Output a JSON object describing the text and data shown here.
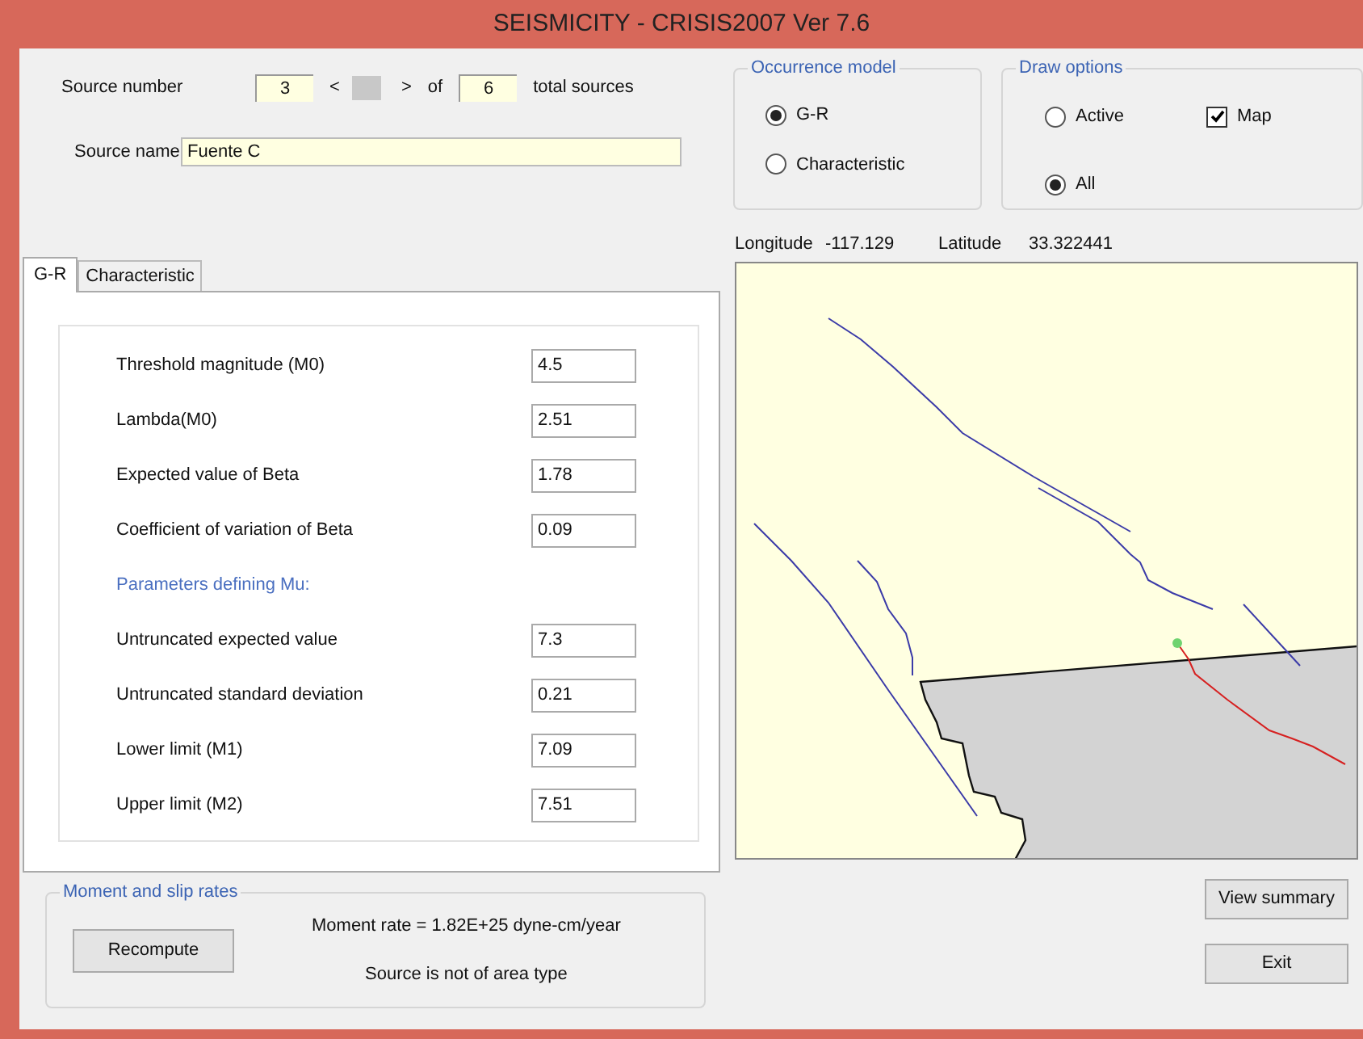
{
  "window": {
    "title": "SEISMICITY - CRISIS2007 Ver 7.6"
  },
  "source_number": {
    "label": "Source number",
    "value": "3",
    "prev": "<",
    "next": ">",
    "of": "of",
    "total": "6",
    "total_label": "total sources"
  },
  "source_name": {
    "label": "Source name",
    "value": "Fuente C"
  },
  "occurrence_model": {
    "title": "Occurrence model",
    "options": [
      {
        "label": "G-R",
        "selected": true
      },
      {
        "label": "Characteristic",
        "selected": false
      }
    ]
  },
  "draw_options": {
    "title": "Draw options",
    "items": [
      {
        "kind": "radio",
        "label": "Active",
        "selected": false
      },
      {
        "kind": "checkbox",
        "label": "Map",
        "checked": true
      },
      {
        "kind": "radio",
        "label": "All",
        "selected": true
      }
    ]
  },
  "coordinates": [
    {
      "label": "Longitude",
      "value": "-117.129"
    },
    {
      "label": "Latitude",
      "value": "33.322441"
    }
  ],
  "tabs": [
    {
      "label": "G-R",
      "selected": true
    },
    {
      "label": "Characteristic",
      "selected": false
    }
  ],
  "parameters": [
    {
      "kind": "field",
      "label": "Threshold magnitude (M0)",
      "value": "4.5"
    },
    {
      "kind": "field",
      "label": "Lambda(M0)",
      "value": "2.51"
    },
    {
      "kind": "field",
      "label": "Expected value of Beta",
      "value": "1.78"
    },
    {
      "kind": "field",
      "label": "Coefficient of variation of Beta",
      "value": "0.09"
    },
    {
      "kind": "heading",
      "label": "Parameters defining Mu:"
    },
    {
      "kind": "field",
      "label": "Untruncated expected value",
      "value": "7.3"
    },
    {
      "kind": "field",
      "label": "Untruncated standard deviation",
      "value": "0.21"
    },
    {
      "kind": "field",
      "label": "Lower limit (M1)",
      "value": "7.09"
    },
    {
      "kind": "field",
      "label": "Upper limit (M2)",
      "value": "7.51"
    }
  ],
  "moment_rates": {
    "title": "Moment and slip rates",
    "button": "Recompute",
    "moment_rate": "Moment rate = 1.82E+25 dyne-cm/year",
    "area_note": "Source is not of area type"
  },
  "buttons": [
    {
      "label": "View summary"
    },
    {
      "label": "Exit"
    }
  ]
}
